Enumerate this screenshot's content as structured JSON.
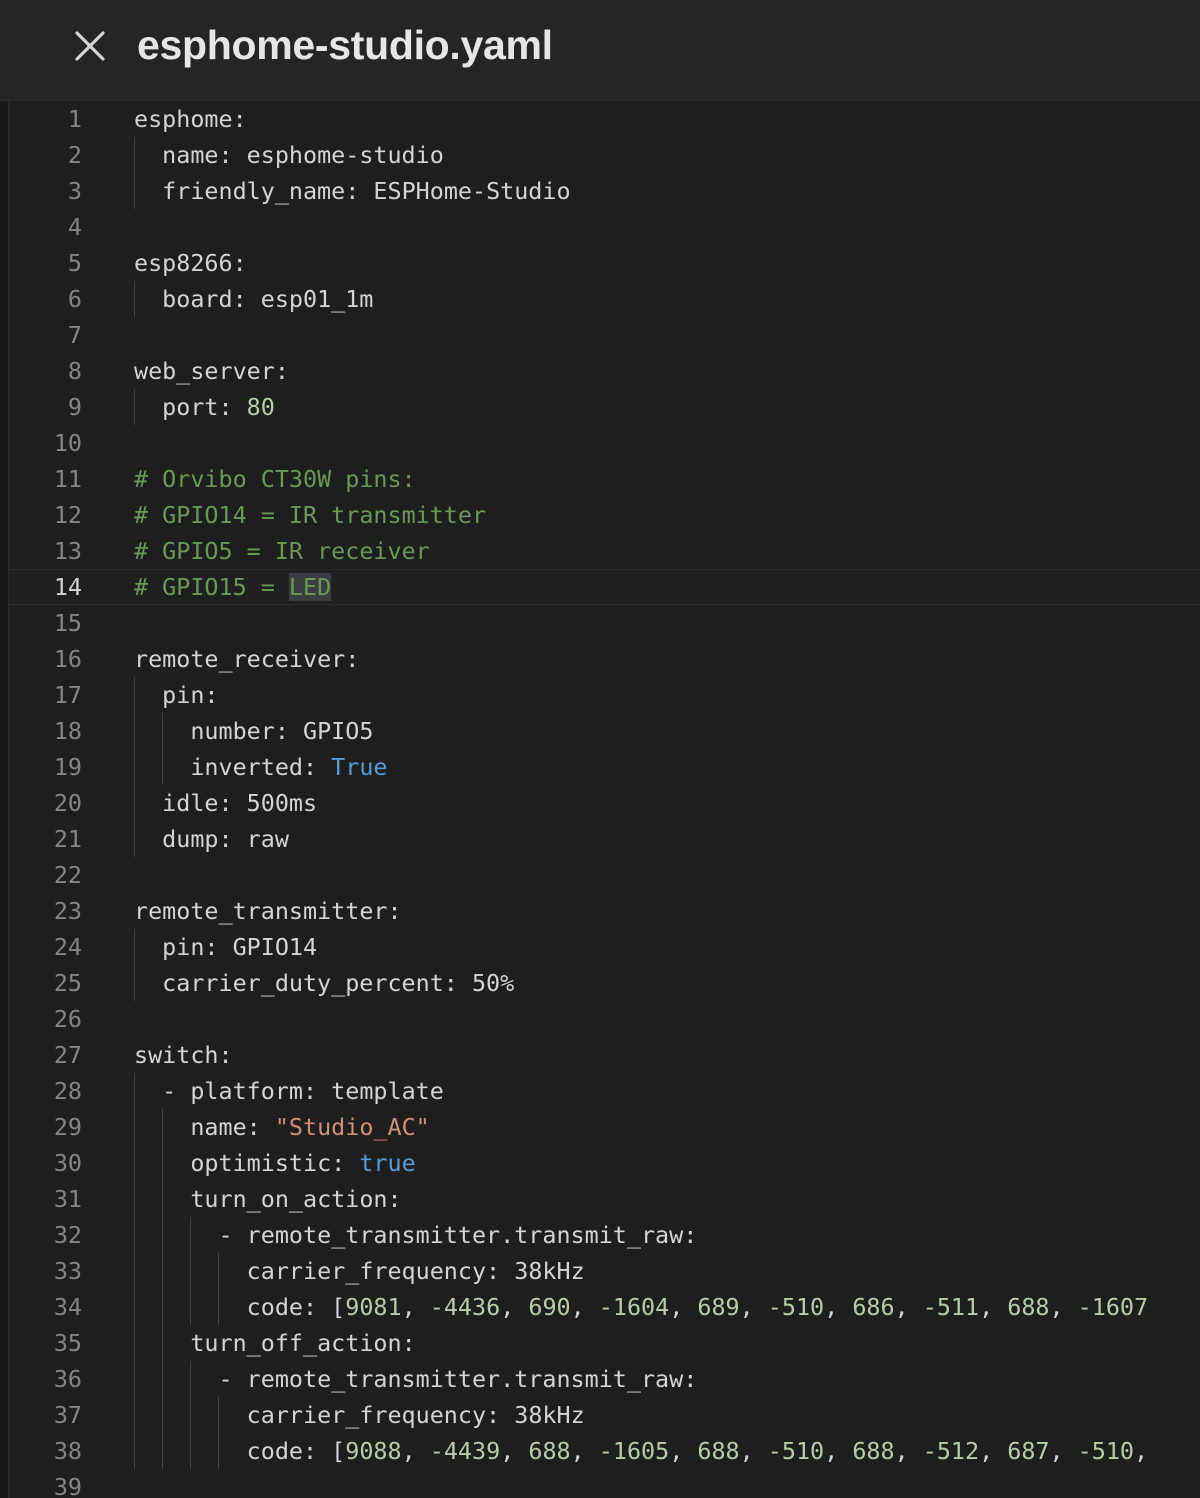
{
  "tab": {
    "close_icon": "close-icon",
    "filename": "esphome-studio.yaml"
  },
  "editor": {
    "current_line": 14,
    "lines": [
      {
        "n": "1",
        "tokens": [
          {
            "t": "esphome:",
            "c": "key"
          }
        ]
      },
      {
        "n": "2",
        "tokens": [
          {
            "t": "name: ",
            "c": "key"
          },
          {
            "t": "esphome-studio",
            "c": "plain"
          }
        ]
      },
      {
        "n": "3",
        "tokens": [
          {
            "t": "friendly_name: ",
            "c": "key"
          },
          {
            "t": "ESPHome-Studio",
            "c": "plain"
          }
        ]
      },
      {
        "n": "4",
        "tokens": []
      },
      {
        "n": "5",
        "tokens": [
          {
            "t": "esp8266:",
            "c": "key"
          }
        ]
      },
      {
        "n": "6",
        "tokens": [
          {
            "t": "board: ",
            "c": "key"
          },
          {
            "t": "esp01_1m",
            "c": "plain"
          }
        ]
      },
      {
        "n": "7",
        "tokens": []
      },
      {
        "n": "8",
        "tokens": [
          {
            "t": "web_server:",
            "c": "key"
          }
        ]
      },
      {
        "n": "9",
        "tokens": [
          {
            "t": "port: ",
            "c": "key"
          },
          {
            "t": "80",
            "c": "num"
          }
        ]
      },
      {
        "n": "10",
        "tokens": []
      },
      {
        "n": "11",
        "tokens": [
          {
            "t": "# Orvibo CT30W pins:",
            "c": "comment"
          }
        ]
      },
      {
        "n": "12",
        "tokens": [
          {
            "t": "# GPIO14 = IR transmitter",
            "c": "comment"
          }
        ]
      },
      {
        "n": "13",
        "tokens": [
          {
            "t": "# GPIO5 = IR receiver",
            "c": "comment"
          }
        ]
      },
      {
        "n": "14",
        "tokens": [
          {
            "t": "# GPIO15 = ",
            "c": "comment"
          },
          {
            "t": "LED",
            "c": "comment sel"
          }
        ]
      },
      {
        "n": "15",
        "tokens": []
      },
      {
        "n": "16",
        "tokens": [
          {
            "t": "remote_receiver:",
            "c": "key"
          }
        ]
      },
      {
        "n": "17",
        "tokens": [
          {
            "t": "pin:",
            "c": "key"
          }
        ]
      },
      {
        "n": "18",
        "tokens": [
          {
            "t": "number: ",
            "c": "key"
          },
          {
            "t": "GPIO5",
            "c": "plain"
          }
        ]
      },
      {
        "n": "19",
        "tokens": [
          {
            "t": "inverted: ",
            "c": "key"
          },
          {
            "t": "True",
            "c": "bool"
          }
        ]
      },
      {
        "n": "20",
        "tokens": [
          {
            "t": "idle: ",
            "c": "key"
          },
          {
            "t": "500ms",
            "c": "plain"
          }
        ]
      },
      {
        "n": "21",
        "tokens": [
          {
            "t": "dump: ",
            "c": "key"
          },
          {
            "t": "raw",
            "c": "plain"
          }
        ]
      },
      {
        "n": "22",
        "tokens": []
      },
      {
        "n": "23",
        "tokens": [
          {
            "t": "remote_transmitter:",
            "c": "key"
          }
        ]
      },
      {
        "n": "24",
        "tokens": [
          {
            "t": "pin: ",
            "c": "key"
          },
          {
            "t": "GPIO14",
            "c": "plain"
          }
        ]
      },
      {
        "n": "25",
        "tokens": [
          {
            "t": "carrier_duty_percent: ",
            "c": "key"
          },
          {
            "t": "50%",
            "c": "plain"
          }
        ]
      },
      {
        "n": "26",
        "tokens": []
      },
      {
        "n": "27",
        "tokens": [
          {
            "t": "switch:",
            "c": "key"
          }
        ]
      },
      {
        "n": "28",
        "tokens": [
          {
            "t": "- ",
            "c": "plain"
          },
          {
            "t": "platform: ",
            "c": "key"
          },
          {
            "t": "template",
            "c": "plain"
          }
        ]
      },
      {
        "n": "29",
        "tokens": [
          {
            "t": "name: ",
            "c": "key"
          },
          {
            "t": "\"Studio_AC\"",
            "c": "str"
          }
        ]
      },
      {
        "n": "30",
        "tokens": [
          {
            "t": "optimistic: ",
            "c": "key"
          },
          {
            "t": "true",
            "c": "bool"
          }
        ]
      },
      {
        "n": "31",
        "tokens": [
          {
            "t": "turn_on_action:",
            "c": "key"
          }
        ]
      },
      {
        "n": "32",
        "tokens": [
          {
            "t": "- ",
            "c": "plain"
          },
          {
            "t": "remote_transmitter.transmit_raw:",
            "c": "key"
          }
        ]
      },
      {
        "n": "33",
        "tokens": [
          {
            "t": "carrier_frequency: ",
            "c": "key"
          },
          {
            "t": "38kHz",
            "c": "plain"
          }
        ]
      },
      {
        "n": "34",
        "tokens": [
          {
            "t": "code: ",
            "c": "key"
          },
          {
            "t": "[",
            "c": "plain"
          },
          {
            "t": "9081",
            "c": "num"
          },
          {
            "t": ", ",
            "c": "plain"
          },
          {
            "t": "-4436",
            "c": "num"
          },
          {
            "t": ", ",
            "c": "plain"
          },
          {
            "t": "690",
            "c": "num"
          },
          {
            "t": ", ",
            "c": "plain"
          },
          {
            "t": "-1604",
            "c": "num"
          },
          {
            "t": ", ",
            "c": "plain"
          },
          {
            "t": "689",
            "c": "num"
          },
          {
            "t": ", ",
            "c": "plain"
          },
          {
            "t": "-510",
            "c": "num"
          },
          {
            "t": ", ",
            "c": "plain"
          },
          {
            "t": "686",
            "c": "num"
          },
          {
            "t": ", ",
            "c": "plain"
          },
          {
            "t": "-511",
            "c": "num"
          },
          {
            "t": ", ",
            "c": "plain"
          },
          {
            "t": "688",
            "c": "num"
          },
          {
            "t": ", ",
            "c": "plain"
          },
          {
            "t": "-1607",
            "c": "num"
          }
        ]
      },
      {
        "n": "35",
        "tokens": [
          {
            "t": "turn_off_action:",
            "c": "key"
          }
        ]
      },
      {
        "n": "36",
        "tokens": [
          {
            "t": "- ",
            "c": "plain"
          },
          {
            "t": "remote_transmitter.transmit_raw:",
            "c": "key"
          }
        ]
      },
      {
        "n": "37",
        "tokens": [
          {
            "t": "carrier_frequency: ",
            "c": "key"
          },
          {
            "t": "38kHz",
            "c": "plain"
          }
        ]
      },
      {
        "n": "38",
        "tokens": [
          {
            "t": "code: ",
            "c": "key"
          },
          {
            "t": "[",
            "c": "plain"
          },
          {
            "t": "9088",
            "c": "num"
          },
          {
            "t": ", ",
            "c": "plain"
          },
          {
            "t": "-4439",
            "c": "num"
          },
          {
            "t": ", ",
            "c": "plain"
          },
          {
            "t": "688",
            "c": "num"
          },
          {
            "t": ", ",
            "c": "plain"
          },
          {
            "t": "-1605",
            "c": "num"
          },
          {
            "t": ", ",
            "c": "plain"
          },
          {
            "t": "688",
            "c": "num"
          },
          {
            "t": ", ",
            "c": "plain"
          },
          {
            "t": "-510",
            "c": "num"
          },
          {
            "t": ", ",
            "c": "plain"
          },
          {
            "t": "688",
            "c": "num"
          },
          {
            "t": ", ",
            "c": "plain"
          },
          {
            "t": "-512",
            "c": "num"
          },
          {
            "t": ", ",
            "c": "plain"
          },
          {
            "t": "687",
            "c": "num"
          },
          {
            "t": ", ",
            "c": "plain"
          },
          {
            "t": "-510",
            "c": "num"
          },
          {
            "t": ",",
            "c": "plain"
          }
        ]
      },
      {
        "n": "39",
        "tokens": []
      }
    ]
  }
}
